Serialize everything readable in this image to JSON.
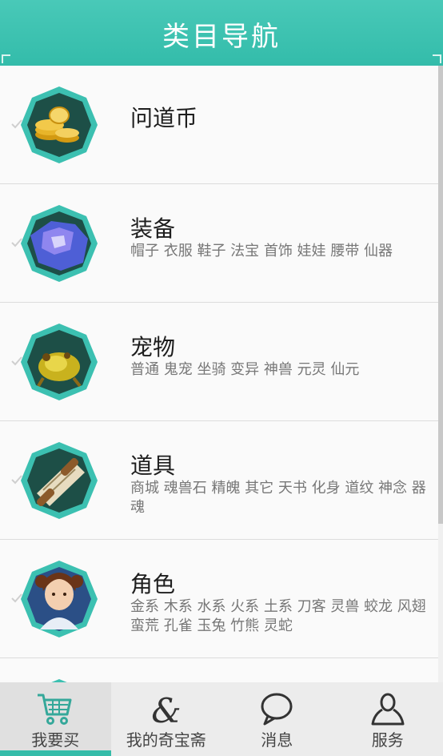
{
  "header": {
    "title": "类目导航"
  },
  "colors": {
    "accent": "#35bca9",
    "header_bg": "#42c4b2"
  },
  "categories": [
    {
      "title": "问道币",
      "tags": "",
      "icon": "gold-coins-icon"
    },
    {
      "title": "装备",
      "tags": "帽子 衣服 鞋子 法宝 首饰 娃娃 腰带 仙器",
      "icon": "armor-icon"
    },
    {
      "title": "宠物",
      "tags": "普通 鬼宠 坐骑 变异 神兽 元灵 仙元",
      "icon": "pet-icon"
    },
    {
      "title": "道具",
      "tags": "商城 魂兽石 精魄 其它 天书 化身 道纹 神念 器魂",
      "icon": "scroll-icon"
    },
    {
      "title": "角色",
      "tags": "金系 木系 水系 火系 土系 刀客 灵兽 蛟龙 风翅 蛮荒 孔雀 玉兔 竹熊 灵蛇",
      "icon": "character-icon"
    }
  ],
  "tabbar": [
    {
      "label": "我要买",
      "icon": "cart-icon",
      "active": true
    },
    {
      "label": "我的奇宝斋",
      "icon": "ampersand-icon",
      "active": false
    },
    {
      "label": "消息",
      "icon": "message-icon",
      "active": false
    },
    {
      "label": "服务",
      "icon": "user-icon",
      "active": false
    }
  ]
}
